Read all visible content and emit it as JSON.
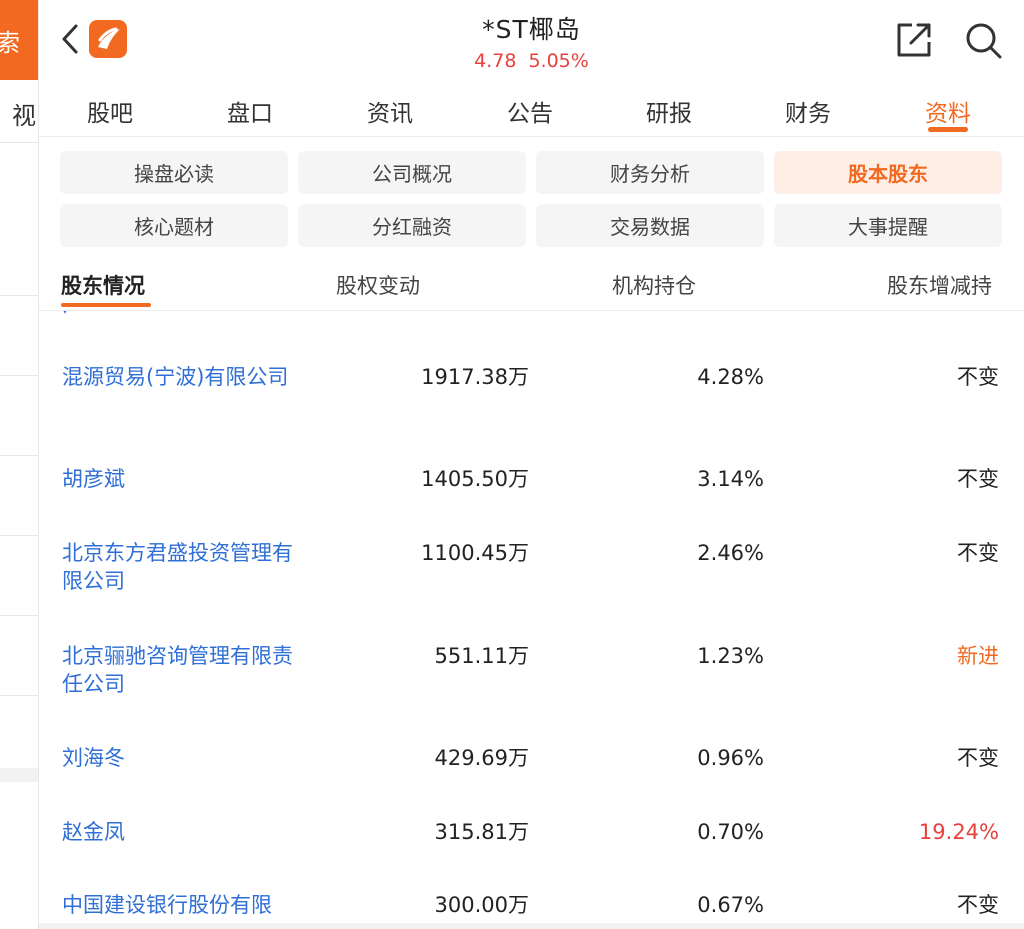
{
  "left_panel": {
    "tab_label": "索",
    "item_label": "视"
  },
  "header": {
    "title": "*ST椰岛",
    "price": "4.78",
    "change_pct": "5.05%"
  },
  "nav": {
    "items": [
      {
        "label": "股吧"
      },
      {
        "label": "盘口"
      },
      {
        "label": "资讯"
      },
      {
        "label": "公告"
      },
      {
        "label": "研报"
      },
      {
        "label": "财务"
      },
      {
        "label": "资料"
      }
    ],
    "active": "资料"
  },
  "sections": [
    {
      "label": "操盘必读"
    },
    {
      "label": "公司概况"
    },
    {
      "label": "财务分析"
    },
    {
      "label": "股本股东"
    },
    {
      "label": "核心题材"
    },
    {
      "label": "分红融资"
    },
    {
      "label": "交易数据"
    },
    {
      "label": "大事提醒"
    }
  ],
  "subtabs": [
    {
      "label": "股东情况"
    },
    {
      "label": "股权变动"
    },
    {
      "label": "机构持仓"
    },
    {
      "label": "股东增减持"
    }
  ],
  "shareholders": [
    {
      "name": "混源贸易(宁波)有限公司",
      "shares": "1917.38万",
      "ratio": "4.28%",
      "change": "不变"
    },
    {
      "name": "胡彦斌",
      "shares": "1405.50万",
      "ratio": "3.14%",
      "change": "不变"
    },
    {
      "name": "北京东方君盛投资管理有限公司",
      "shares": "1100.45万",
      "ratio": "2.46%",
      "change": "不变"
    },
    {
      "name": "北京骊驰咨询管理有限责任公司",
      "shares": "551.11万",
      "ratio": "1.23%",
      "change": "新进"
    },
    {
      "name": "刘海冬",
      "shares": "429.69万",
      "ratio": "0.96%",
      "change": "不变"
    },
    {
      "name": "赵金凤",
      "shares": "315.81万",
      "ratio": "0.70%",
      "change": "19.24%"
    },
    {
      "name": "中国建设银行股份有限",
      "shares": "300.00万",
      "ratio": "0.67%",
      "change": "不变"
    }
  ],
  "colors": {
    "accent": "#f26a21",
    "up": "#e8413b",
    "link": "#2f6fd6"
  }
}
